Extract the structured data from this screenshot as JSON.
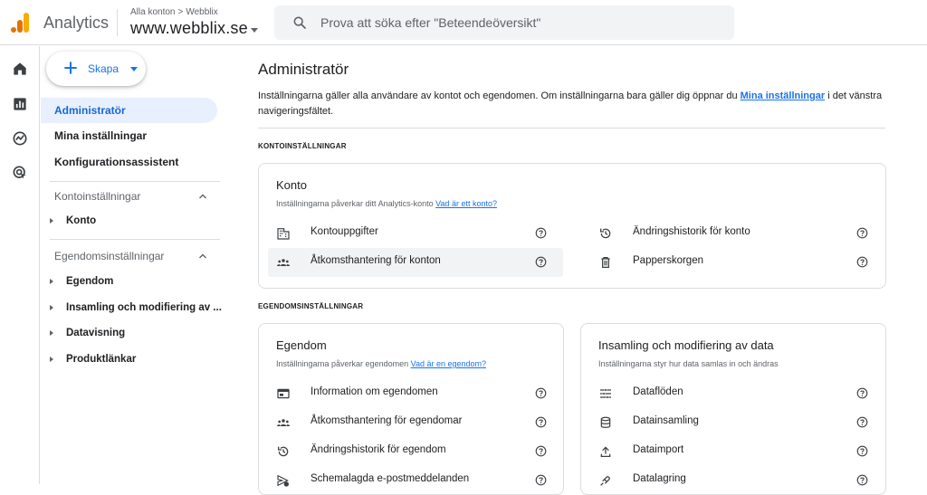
{
  "topbar": {
    "product_name": "Analytics",
    "account_crumb_parent": "Alla konton",
    "account_crumb_sep": ">",
    "account_crumb_account": "Webblix",
    "property_name": "www.webblix.se",
    "search_placeholder": "Prova att söka efter \"Beteendeöversikt\""
  },
  "colors": {
    "accent": "#1a73e8",
    "active_bg": "#e8f0fe",
    "logo_orange": "#f9ab00",
    "logo_dark": "#e37400"
  },
  "rail": {
    "icons": [
      "home-icon",
      "reports-icon",
      "explore-icon",
      "advertising-icon"
    ]
  },
  "sidebar": {
    "create_label": "Skapa",
    "items": [
      {
        "label": "Administratör",
        "active": true
      },
      {
        "label": "Mina inställningar"
      },
      {
        "label": "Konfigurationsassistent"
      }
    ],
    "sections": [
      {
        "label": "Kontoinställningar",
        "items": [
          "Konto"
        ]
      },
      {
        "label": "Egendomsinställningar",
        "items": [
          "Egendom",
          "Insamling och modifiering av ...",
          "Datavisning",
          "Produktlänkar"
        ]
      }
    ]
  },
  "main": {
    "title": "Administratör",
    "intro_text": "Inställningarna gäller alla användare av kontot och egendomen. Om inställningarna bara gäller dig öppnar du ",
    "intro_link": "Mina inställningar",
    "intro_text_end": " i det vänstra navigeringsfältet.",
    "account_section_label": "KONTOINSTÄLLNINGAR",
    "property_section_label": "EGENDOMSINSTÄLLNINGAR",
    "account_card": {
      "title": "Konto",
      "desc": "Inställningarna påverkar ditt Analytics-konto ",
      "link": "Vad är ett konto?",
      "left": [
        "Kontouppgifter",
        "Åtkomsthantering för konton"
      ],
      "right": [
        "Ändringshistorik för konto",
        "Papperskorgen"
      ]
    },
    "property_card": {
      "title": "Egendom",
      "desc": "Inställningarna påverkar egendomen ",
      "link": "Vad är en egendom?",
      "rows": [
        "Information om egendomen",
        "Åtkomsthantering för egendomar",
        "Ändringshistorik för egendom",
        "Schemalagda e-postmeddelanden"
      ]
    },
    "data_card": {
      "title": "Insamling och modifiering av data",
      "desc": "Inställningarna styr hur data samlas in och ändras",
      "rows": [
        "Dataflöden",
        "Datainsamling",
        "Dataimport",
        "Datalagring"
      ]
    }
  }
}
